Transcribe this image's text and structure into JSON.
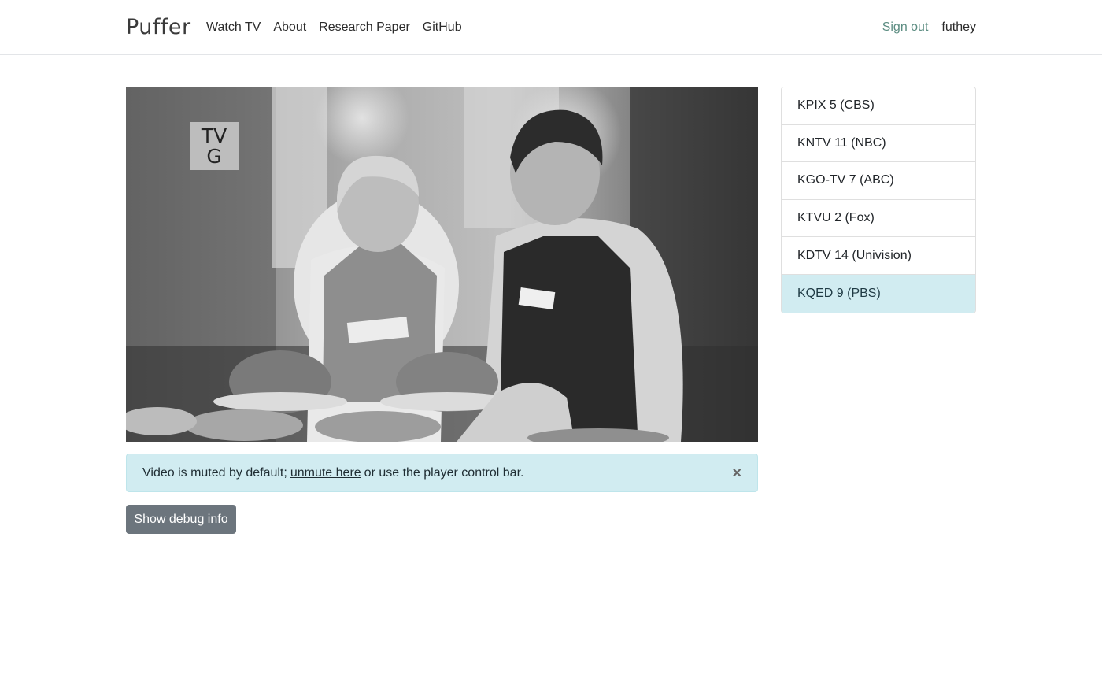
{
  "brand": {
    "logo_text": "Puffer"
  },
  "nav": {
    "links": [
      "Watch TV",
      "About",
      "Research Paper",
      "GitHub"
    ],
    "sign_out": "Sign out",
    "username": "futhey"
  },
  "video": {
    "rating_line1": "TV",
    "rating_line2": "G"
  },
  "alert": {
    "text_before": "Video is muted by default;",
    "link_text": "unmute here",
    "text_after": "or use the player control bar.",
    "close_symbol": "×"
  },
  "debug_button": {
    "label": "Show debug info"
  },
  "channels": {
    "items": [
      {
        "label": "KPIX 5 (CBS)",
        "active": false
      },
      {
        "label": "KNTV 11 (NBC)",
        "active": false
      },
      {
        "label": "KGO-TV 7 (ABC)",
        "active": false
      },
      {
        "label": "KTVU 2 (Fox)",
        "active": false
      },
      {
        "label": "KDTV 14 (Univision)",
        "active": false
      },
      {
        "label": "KQED 9 (PBS)",
        "active": true
      }
    ]
  },
  "colors": {
    "active_channel": "#d1ecf1",
    "alert_background": "#d1ecf1",
    "debug_button": "#6c757d",
    "sign_out_link": "#5c8d82"
  }
}
